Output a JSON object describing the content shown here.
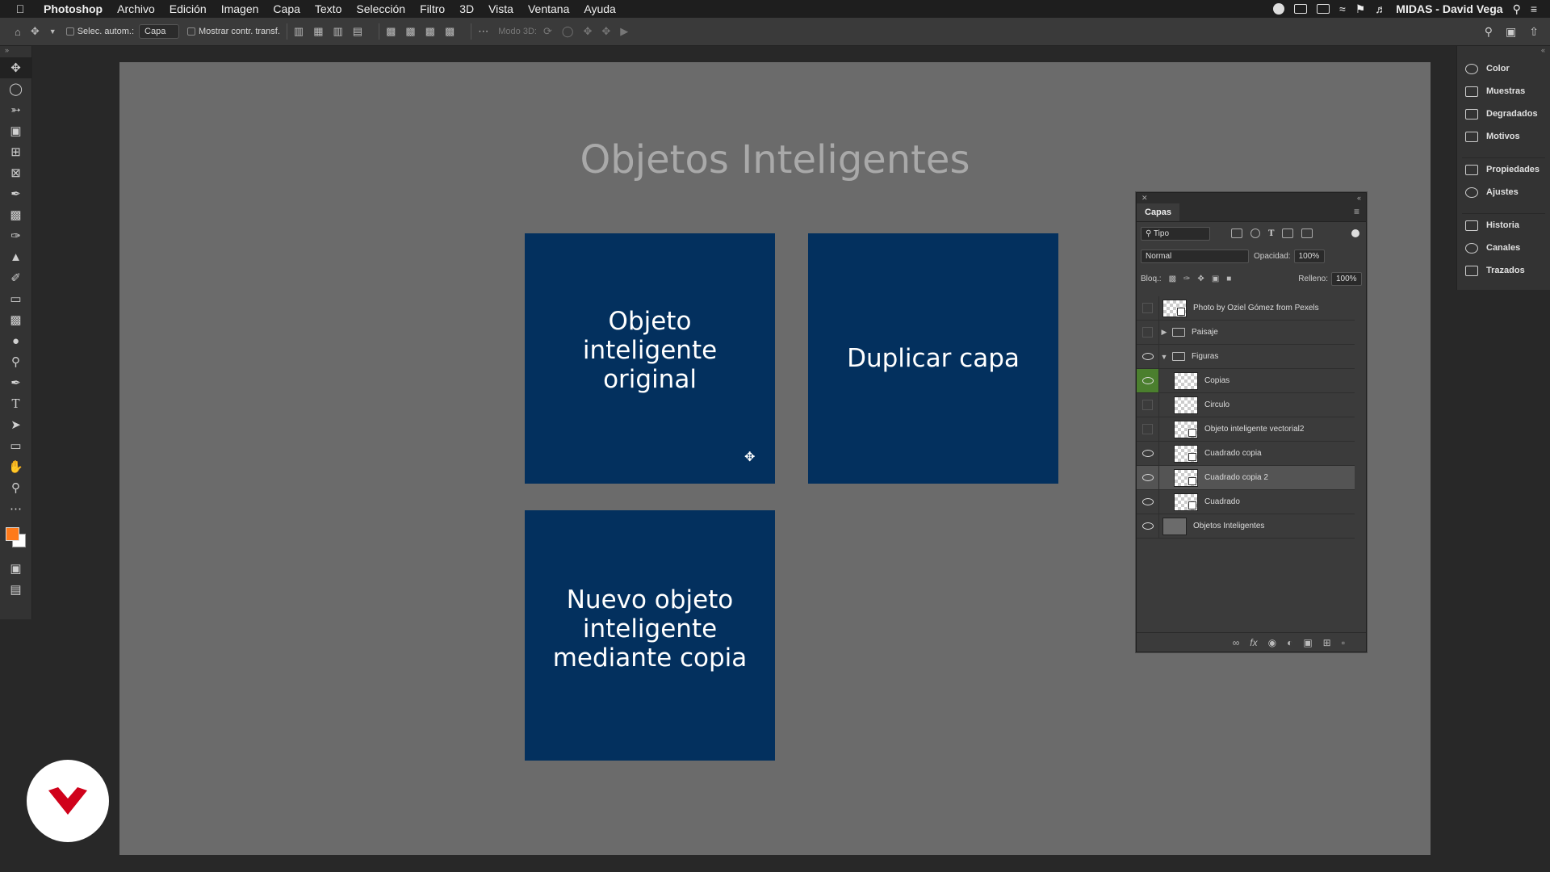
{
  "menubar": {
    "app_name": "Photoshop",
    "items": [
      "Archivo",
      "Edición",
      "Imagen",
      "Capa",
      "Texto",
      "Selección",
      "Filtro",
      "3D",
      "Vista",
      "Ventana",
      "Ayuda"
    ],
    "user": "MIDAS - David Vega"
  },
  "options": {
    "auto_select_label": "Selec. autom.:",
    "auto_select_value": "Capa",
    "show_transform_label": "Mostrar contr. transf.",
    "mode_3d_label": "Modo 3D:"
  },
  "document": {
    "title": "Objetos Inteligentes",
    "cards": {
      "original": "Objeto inteligente original",
      "duplicate": "Duplicar capa",
      "new_copy": "Nuevo objeto inteligente mediante copia"
    },
    "card_color": "#03305e"
  },
  "layers_panel": {
    "tab": "Capas",
    "filter_kind": "Tipo",
    "blend_mode": "Normal",
    "opacity_label": "Opacidad:",
    "opacity_value": "100%",
    "lock_label": "Bloq.:",
    "fill_label": "Relleno:",
    "fill_value": "100%",
    "layers": [
      {
        "name": "Photo by Oziel Gómez from Pexels",
        "visible": false
      },
      {
        "name": "Paisaje",
        "visible": false,
        "type": "group",
        "expanded": false
      },
      {
        "name": "Figuras",
        "visible": true,
        "type": "group",
        "expanded": true
      },
      {
        "name": "Copias",
        "visible": true
      },
      {
        "name": "Circulo",
        "visible": false
      },
      {
        "name": "Objeto inteligente vectorial2",
        "visible": false
      },
      {
        "name": "Cuadrado copia",
        "visible": true
      },
      {
        "name": "Cuadrado copia 2",
        "visible": true,
        "selected": true
      },
      {
        "name": "Cuadrado",
        "visible": true
      },
      {
        "name": "Objetos Inteligentes",
        "visible": true
      }
    ]
  },
  "right_dock": {
    "items": [
      "Color",
      "Muestras",
      "Degradados",
      "Motivos",
      "Propiedades",
      "Ajustes",
      "Historia",
      "Canales",
      "Trazados"
    ]
  },
  "colors": {
    "foreground": "#ff7a1a",
    "background": "#ffffff",
    "canvas": "#6b6b6b"
  }
}
